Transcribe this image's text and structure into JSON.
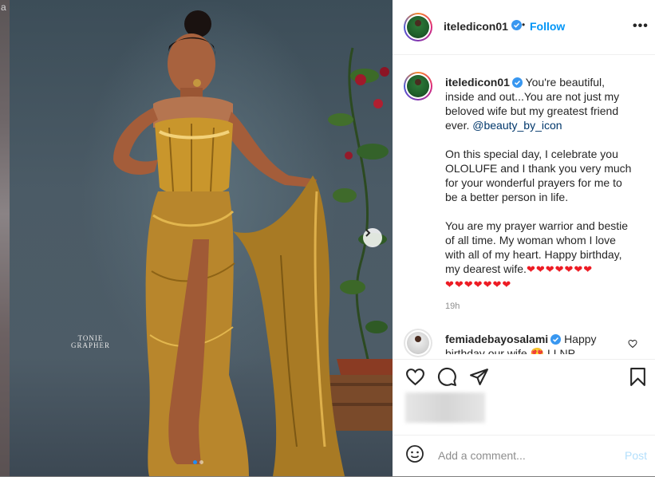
{
  "background": {
    "edge_text": "a"
  },
  "photo": {
    "watermark_line1": "TONIE",
    "watermark_line2": "GRAPHER",
    "carousel": {
      "total": 2,
      "active": 1
    }
  },
  "header": {
    "username": "iteledicon01",
    "follow_label": "Follow",
    "separator": "•",
    "more_label": "•••"
  },
  "caption": {
    "username": "iteledicon01",
    "intro": "You're beautiful, inside and out...You are not just my beloved wife but my greatest friend ever.",
    "mention": "@beauty_by_icon",
    "paragraph2": "On this special day, I celebrate you OLOLUFE and I thank you very much for your wonderful prayers for me to be a better person in life.",
    "paragraph3": "You are my prayer warrior and bestie of all time. My woman whom I love with all of my heart. Happy birthday, my dearest wife.",
    "hearts_line1": "❤❤❤❤❤❤❤",
    "hearts_line2": "❤❤❤❤❤❤❤",
    "timestamp": "19h"
  },
  "comment": {
    "username": "femiadebayosalami",
    "text": "Happy birthday our wife",
    "emoji": "😍",
    "tail": "LLNP"
  },
  "add_comment": {
    "placeholder": "Add a comment...",
    "post_label": "Post"
  },
  "colors": {
    "accent": "#0095f6",
    "verified": "#3897f0",
    "heart": "#ed1c24",
    "post_disabled": "#b2dffc"
  },
  "icons": {
    "verified": "verified-badge-icon",
    "next": "chevron-right-icon",
    "like": "heart-outline-icon",
    "comment": "speech-bubble-icon",
    "share": "paper-plane-icon",
    "save": "bookmark-icon",
    "emoji": "smiley-icon"
  }
}
